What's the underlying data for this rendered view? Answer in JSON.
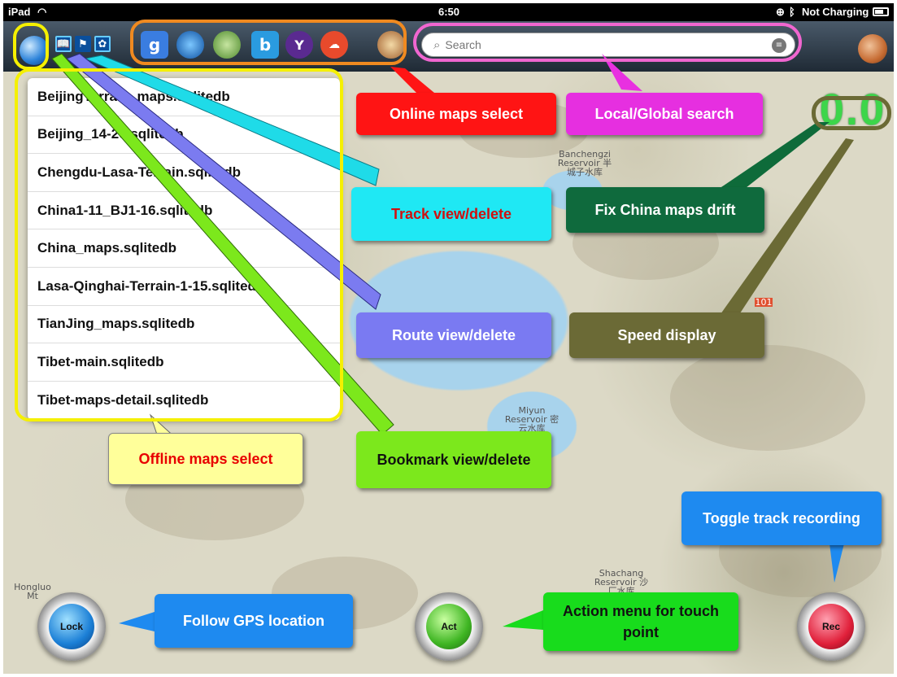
{
  "status_bar": {
    "device": "iPad",
    "wifi_icon": "wifi-icon",
    "time": "6:50",
    "charging": "Not Charging"
  },
  "toolbar": {
    "globe_icon": "globe-icon",
    "bookmark_icon": "book-icon",
    "route_icon": "route-flag-icon",
    "track_icon": "paw-icon",
    "online_icons": [
      "google-icon",
      "earth-icon",
      "world-map-icon",
      "bing-icon",
      "yahoo-icon",
      "cloudmade-icon",
      "custom-map-icon"
    ],
    "avatar_icon": "mars-avatar-icon"
  },
  "search": {
    "placeholder": "Search"
  },
  "offline_maps": [
    "BeijingTerrain_maps.sqlitedb",
    "Beijing_14-20.sqlitedb",
    "Chengdu-Lasa-Terrain.sqlitedb",
    "China1-11_BJ1-16.sqlitedb",
    "China_maps.sqlitedb",
    "Lasa-Qinghai-Terrain-1-15.sqlitedb",
    "TianJing_maps.sqlitedb",
    "Tibet-main.sqlitedb",
    "Tibet-maps-detail.sqlitedb"
  ],
  "speed": "0.0",
  "callouts": {
    "online_maps": "Online maps select",
    "search": "Local/Global search",
    "track": "Track view/delete",
    "fix_china": "Fix China maps drift",
    "route": "Route view/delete",
    "speed": "Speed display",
    "offline": "Offline maps select",
    "bookmark": "Bookmark view/delete",
    "toggle_track": "Toggle track recording",
    "follow_gps": "Follow GPS location",
    "action_menu": "Action menu for touch point"
  },
  "buttons": {
    "lock": "Lock",
    "act": "Act",
    "rec": "Rec"
  },
  "map_labels": {
    "banchengzi": "Banchengzi Reservoir 半城子水库",
    "miyun": "Miyun Reservoir 密云水库",
    "shachang": "Shachang Reservoir 沙厂水库",
    "hongluo": "Hongluo Mt",
    "highway": "101"
  }
}
